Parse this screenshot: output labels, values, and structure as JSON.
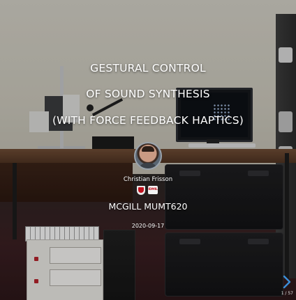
{
  "slide": {
    "title_lines": [
      "GESTURAL CONTROL",
      "OF SOUND SYNTHESIS",
      "(WITH FORCE FEEDBACK HAPTICS)"
    ],
    "author": "Christian Frisson",
    "logos": {
      "university": "mcgill-shield",
      "lab_text": "IDMIL"
    },
    "course": "MCGILL MUMT620",
    "date": "2020-09-17"
  },
  "navigation": {
    "next_icon": "chevron-right-icon",
    "counter": "1 / 57"
  },
  "colors": {
    "text": "#ffffff",
    "nav_accent": "#3b8fd9",
    "logo_red": "#c1121f"
  }
}
